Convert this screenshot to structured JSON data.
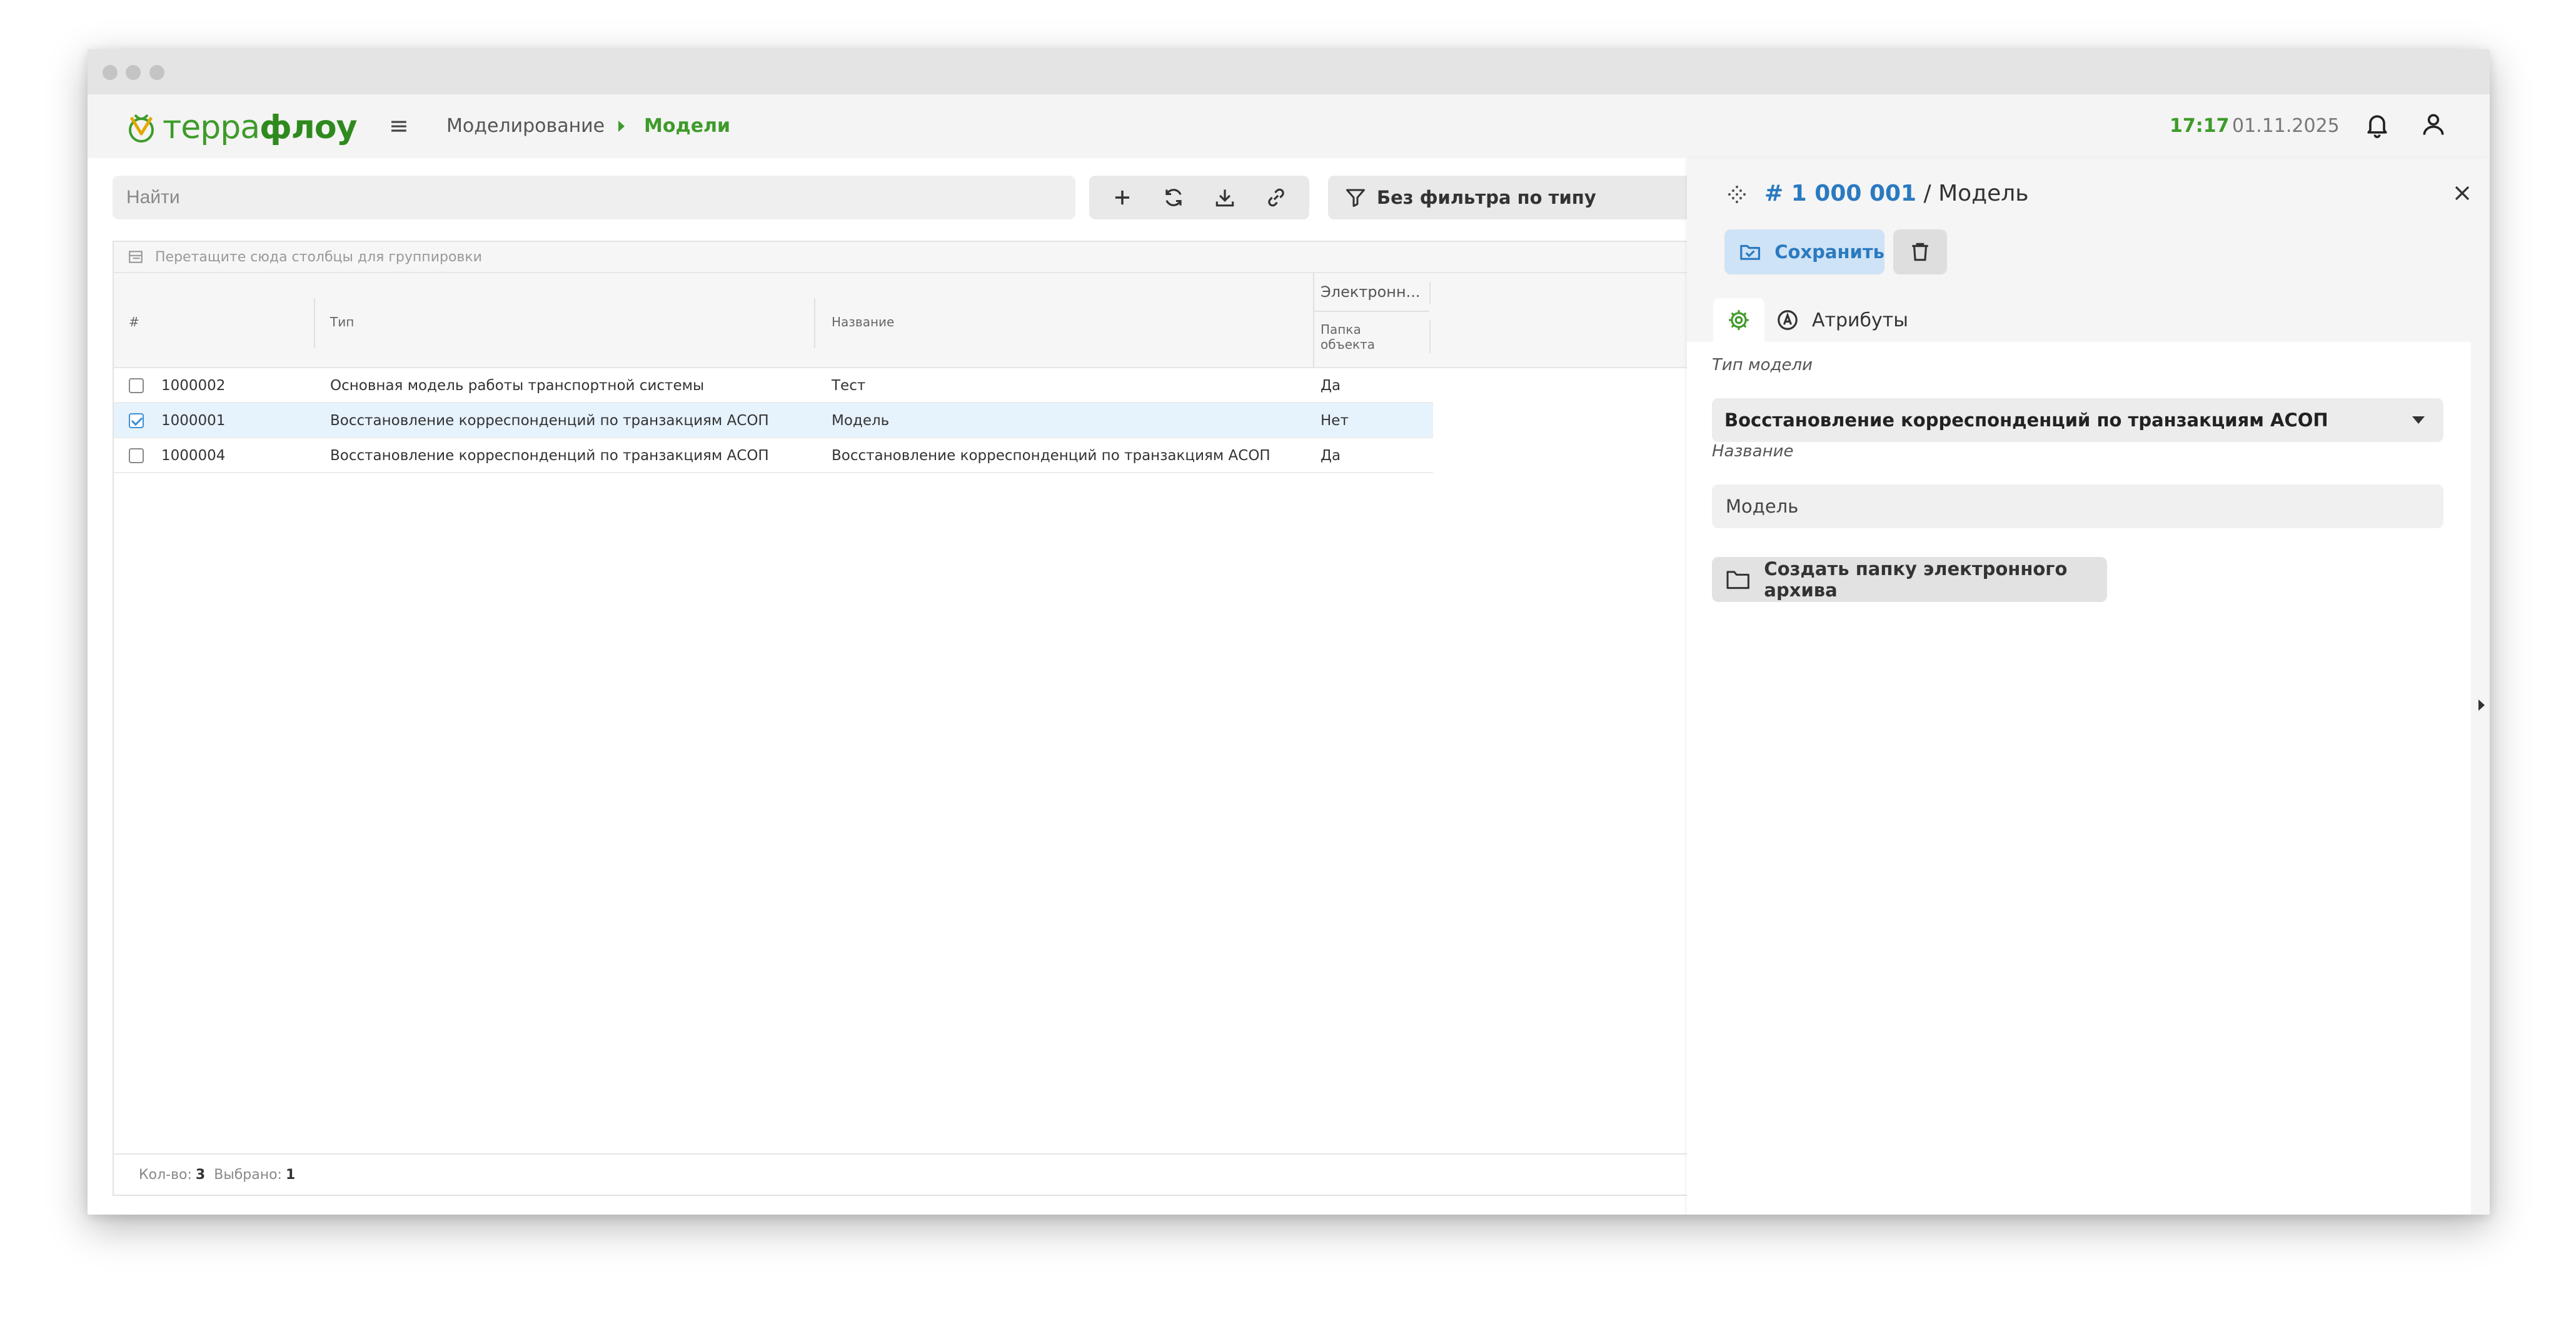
{
  "app": {
    "logo_part1": "терра",
    "logo_part2": "флоу",
    "menu_icon": "≡",
    "breadcrumb": {
      "parent": "Моделирование",
      "current": "Модели"
    },
    "time": "17:17",
    "date": "01.11.2025"
  },
  "toolbar": {
    "search_placeholder": "Найти",
    "filter_label": "Без фильтра по типу",
    "icons": [
      "plus-icon",
      "refresh-icon",
      "download-icon",
      "link-icon"
    ]
  },
  "grid": {
    "group_hint": "Перетащите сюда столбцы для группировки",
    "headers": {
      "num": "#",
      "type": "Тип",
      "name": "Название",
      "group": "Электронн...",
      "folder": "Папка объекта"
    },
    "rows": [
      {
        "id": "1000002",
        "type": "Основная модель работы транспортной системы",
        "name": "Тест",
        "folder": "Да",
        "selected": false
      },
      {
        "id": "1000001",
        "type": "Восстановление корреспонденций по транзакциям АСОП",
        "name": "Модель",
        "folder": "Нет",
        "selected": true
      },
      {
        "id": "1000004",
        "type": "Восстановление корреспонденций по транзакциям АСОП",
        "name": "Восстановление корреспонденций по транзакциям АСОП",
        "folder": "Да",
        "selected": false
      }
    ],
    "footer": {
      "count_label": "Кол-во:",
      "count": "3",
      "selected_label": "Выбрано:",
      "selected": "1"
    }
  },
  "panel": {
    "id_text": "# 1 000 001",
    "title_suffix": " / Модель",
    "save_label": "Сохранить",
    "tab_attributes": "Атрибуты",
    "model_type_label": "Тип модели",
    "model_type_value": "Восстановление корреспонденций по транзакциям АСОП",
    "name_label": "Название",
    "name_value": "Модель",
    "archive_button": "Создать папку электронного архива"
  },
  "colors": {
    "brand_green": "#3e9b2a",
    "link_blue": "#2a7ac0",
    "selected_row": "#e6f2fc"
  }
}
